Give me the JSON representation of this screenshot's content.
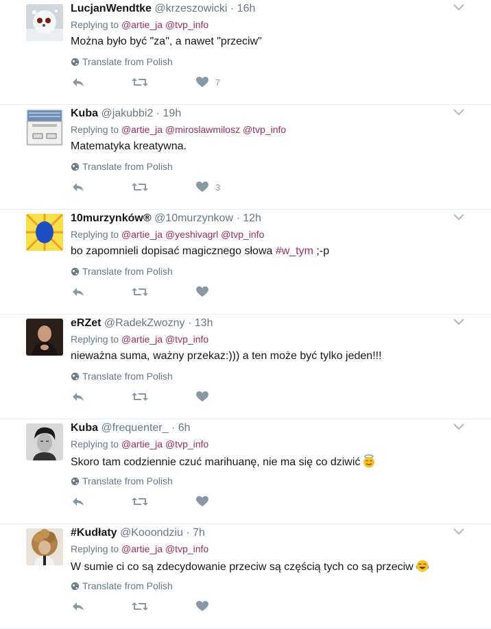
{
  "colors": {
    "mention": "#9c2a5e",
    "muted": "#657786",
    "icon": "#8899a6"
  },
  "translate_label": "Translate from Polish",
  "tweets": [
    {
      "name": "LucjanWendtke",
      "handle": "@krzeszowicki",
      "time": "16h",
      "replying_label": "Replying to",
      "mentions": [
        "@artie_ja",
        "@tvp_info"
      ],
      "text": "Można było być \"za\", a nawet \"przeciw\"",
      "like_count": "7",
      "avatar": "snowman"
    },
    {
      "name": "Kuba",
      "handle": "@jakubbi2",
      "time": "19h",
      "replying_label": "Replying to",
      "mentions": [
        "@artie_ja",
        "@miroslawmilosz",
        "@tvp_info"
      ],
      "text": "Matematyka kreatywna.",
      "like_count": "3",
      "avatar": "dialog-window"
    },
    {
      "name": "10murzynków®",
      "handle": "@10murzynkow",
      "time": "12h",
      "replying_label": "Replying to",
      "mentions": [
        "@artie_ja",
        "@yeshivagrl",
        "@tvp_info"
      ],
      "text_before": "bo zapomnieli dopisać magicznego słowa ",
      "hashtag": "#w_tym",
      "text_after": " ;-p",
      "like_count": "",
      "avatar": "sunburst-egg"
    },
    {
      "name": "eRZet",
      "handle": "@RadekZwozny",
      "time": "13h",
      "replying_label": "Replying to",
      "mentions": [
        "@artie_ja",
        "@tvp_info"
      ],
      "text": "nieważna suma, ważny przekaz:))) a ten może być tylko jeden!!!",
      "like_count": "",
      "avatar": "man-dark"
    },
    {
      "name": "Kuba",
      "handle": "@frequenter_",
      "time": "6h",
      "replying_label": "Replying to",
      "mentions": [
        "@artie_ja",
        "@tvp_info"
      ],
      "text": "Skoro tam codziennie czuć marihuanę, nie ma się co dziwić",
      "emoji": "smiling-face-with-halo",
      "like_count": "",
      "avatar": "man-bw"
    },
    {
      "name": "#Kudłaty",
      "handle": "@Kooondziu",
      "time": "7h",
      "replying_label": "Replying to",
      "mentions": [
        "@artie_ja",
        "@tvp_info"
      ],
      "text": "W sumie ci co są zdecydowanie przeciw są częścią tych co są przeciw",
      "emoji": "face-with-tears-of-joy",
      "like_count": "",
      "avatar": "curly-hair"
    }
  ]
}
